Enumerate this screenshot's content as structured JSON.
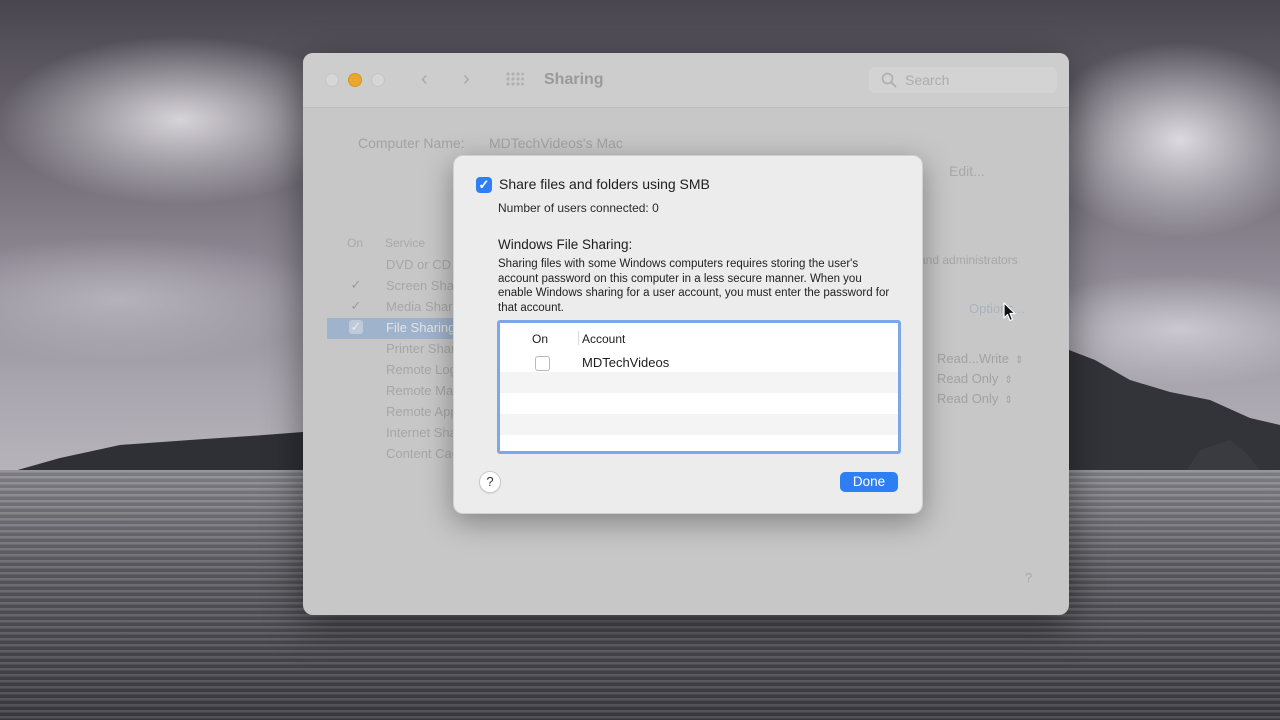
{
  "window": {
    "title": "Sharing",
    "search_placeholder": "Search",
    "computer_name_label": "Computer Name:",
    "computer_name_value": "MDTechVideos's Mac",
    "edit_button": "Edit...",
    "columns": {
      "on": "On",
      "service": "Service"
    },
    "services": [
      {
        "name": "DVD or CD Sharing",
        "checked": false,
        "selected": false
      },
      {
        "name": "Screen Sharing",
        "checked": true,
        "selected": false
      },
      {
        "name": "Media Sharing",
        "checked": true,
        "selected": false
      },
      {
        "name": "File Sharing",
        "checked": true,
        "selected": true
      },
      {
        "name": "Printer Sharing",
        "checked": false,
        "selected": false
      },
      {
        "name": "Remote Login",
        "checked": false,
        "selected": false
      },
      {
        "name": "Remote Management",
        "checked": false,
        "selected": false
      },
      {
        "name": "Remote Apple Events",
        "checked": false,
        "selected": false
      },
      {
        "name": "Internet Sharing",
        "checked": false,
        "selected": false
      },
      {
        "name": "Content Caching",
        "checked": false,
        "selected": false
      }
    ],
    "admin_text": "and administrators",
    "options_button": "Options...",
    "permissions": [
      "Read...Write",
      "Read Only",
      "Read Only"
    ],
    "help_label": "?"
  },
  "sheet": {
    "smb_label": "Share files and folders using SMB",
    "smb_checked": true,
    "users_connected": "Number of users connected: 0",
    "wfs_heading": "Windows File Sharing:",
    "wfs_description": "Sharing files with some Windows computers requires storing the user's account password on this computer in a less secure manner. When you enable Windows sharing for a user account, you must enter the password for that account.",
    "table": {
      "col_on": "On",
      "col_account": "Account",
      "rows": [
        {
          "on": false,
          "account": "MDTechVideos"
        }
      ]
    },
    "help_label": "?",
    "done_button": "Done"
  },
  "colors": {
    "accent": "#2f7ff4",
    "table_focus_ring": "#7ea7e8",
    "minimize_button": "#e9a72c"
  }
}
